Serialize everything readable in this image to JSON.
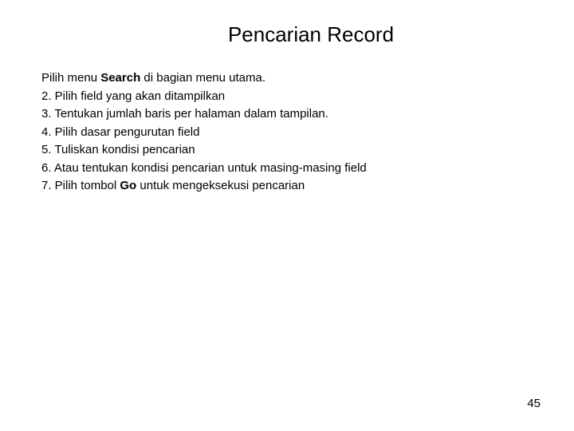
{
  "title": "Pencarian Record",
  "lines": {
    "l1_pre": "Pilih menu ",
    "l1_bold": "Search",
    "l1_post": " di bagian menu utama.",
    "l2": "2. Pilih field yang akan ditampilkan",
    "l3": "3. Tentukan jumlah baris per halaman dalam tampilan.",
    "l4": "4. Pilih dasar pengurutan field",
    "l5": "5. Tuliskan kondisi pencarian",
    "l6": "6. Atau tentukan kondisi pencarian untuk masing-masing field",
    "l7_pre": "7. Pilih tombol ",
    "l7_bold": "Go",
    "l7_post": " untuk mengeksekusi pencarian"
  },
  "page_number": "45"
}
